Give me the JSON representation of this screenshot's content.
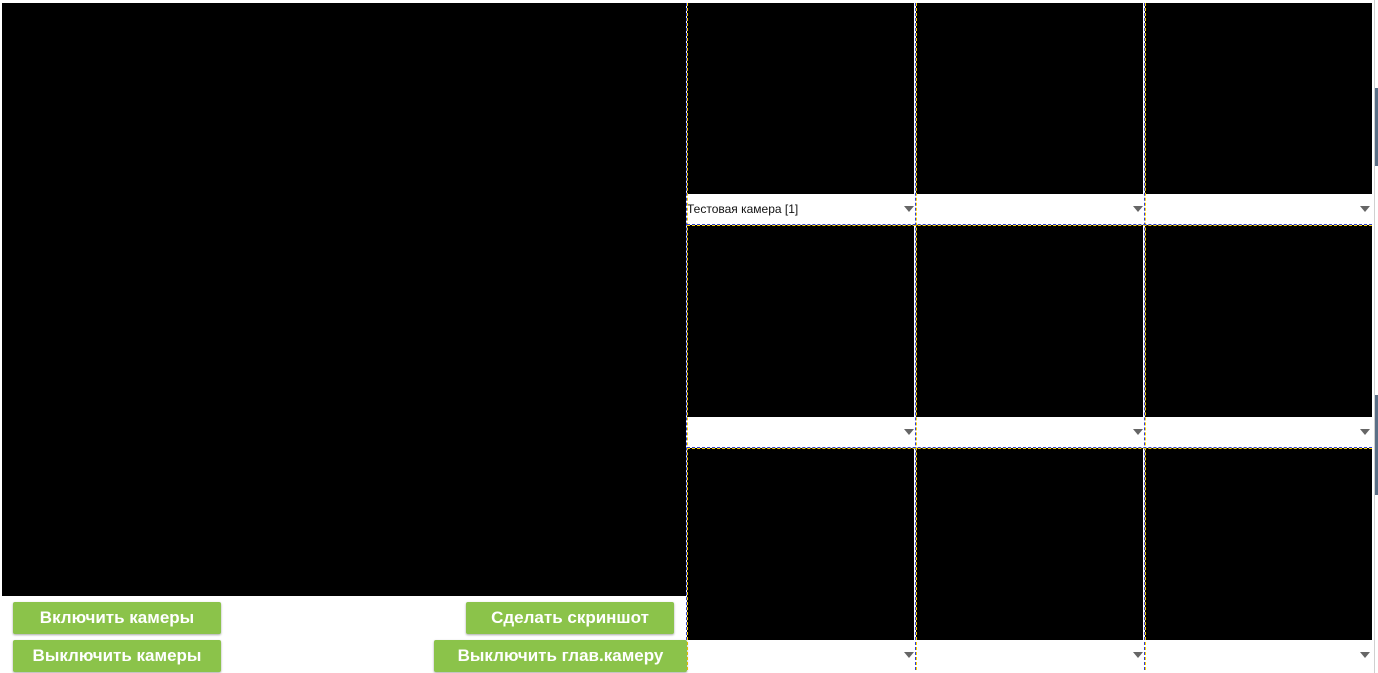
{
  "window": {
    "title": ""
  },
  "controls": {
    "enable_cameras": "Включить камеры",
    "disable_cameras": "Выключить камеры",
    "take_screenshot": "Сделать скриншот",
    "disable_main_camera": "Выключить глав.камеру"
  },
  "camera_grid": {
    "rows": [
      {
        "cells": [
          {
            "selected": "Тестовая камера [1]"
          },
          {
            "selected": ""
          },
          {
            "selected": ""
          }
        ]
      },
      {
        "cells": [
          {
            "selected": ""
          },
          {
            "selected": ""
          },
          {
            "selected": ""
          }
        ]
      },
      {
        "cells": [
          {
            "selected": ""
          },
          {
            "selected": ""
          },
          {
            "selected": ""
          }
        ]
      }
    ]
  },
  "colors": {
    "button_bg": "#8bc34a",
    "button_text": "#ffffff",
    "video_bg": "#000000",
    "divider_yellow": "#ffd400",
    "divider_blue": "#2a3bd6"
  }
}
